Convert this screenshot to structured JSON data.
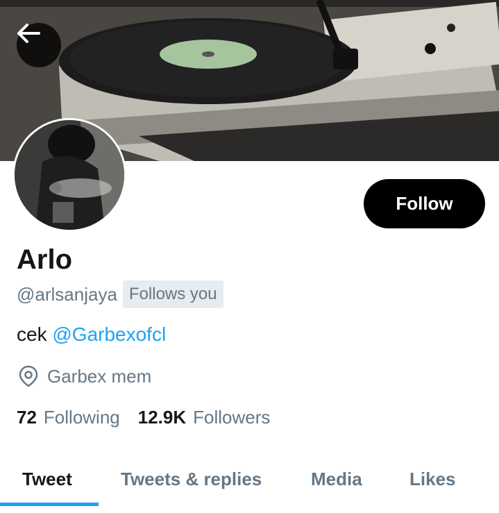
{
  "colors": {
    "accent": "#1da1f2",
    "muted": "#657786",
    "text": "#14171a",
    "follow_button_bg": "#000000"
  },
  "header": {
    "back_icon": "arrow-left-icon"
  },
  "profile": {
    "name": "Arlo",
    "handle": "@arlsanjaya",
    "follows_you_badge": "Follows you",
    "bio_prefix": "cek",
    "bio_mention": "@Garbexofcl",
    "location_icon": "location-pin-icon",
    "location": "Garbex mem",
    "follow_button_label": "Follow"
  },
  "stats": {
    "following_count": "72",
    "following_label": "Following",
    "followers_count": "12.9K",
    "followers_label": "Followers"
  },
  "tabs": [
    {
      "label": "Tweet",
      "active": true
    },
    {
      "label": "Tweets & replies",
      "active": false
    },
    {
      "label": "Media",
      "active": false
    },
    {
      "label": "Likes",
      "active": false
    }
  ]
}
